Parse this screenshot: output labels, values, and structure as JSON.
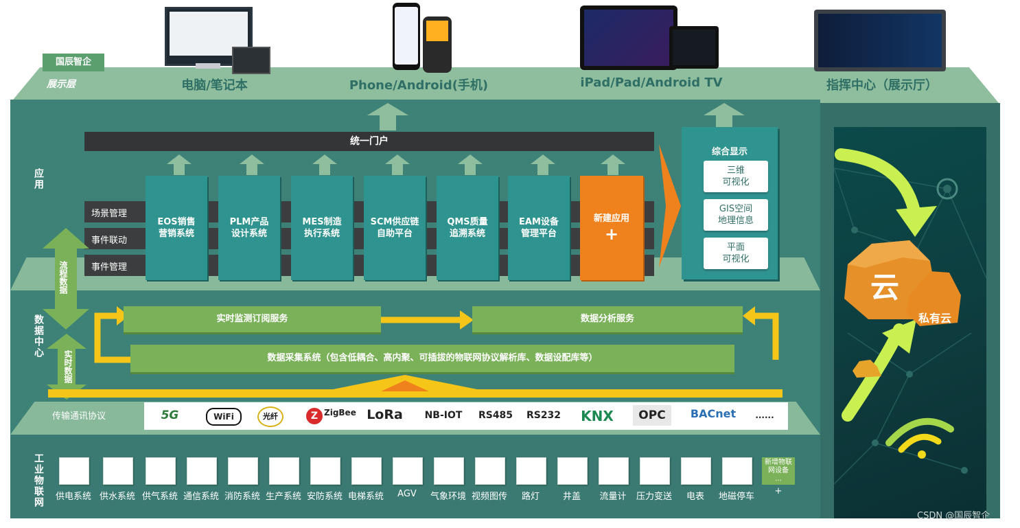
{
  "brand": {
    "name": "国辰智企",
    "layer_tag": "展示层"
  },
  "devices": [
    {
      "label": "电脑/笔记本"
    },
    {
      "label": "Phone/Android(手机)"
    },
    {
      "label": "iPad/Pad/Android TV"
    },
    {
      "label": "指挥中心（展示厅）"
    }
  ],
  "app_layer": {
    "label": "应用",
    "portal": "统一门户",
    "rows": [
      "场景管理",
      "事件联动",
      "事件管理"
    ],
    "modules": [
      {
        "line1": "EOS销售",
        "line2": "营销系统"
      },
      {
        "line1": "PLM产品",
        "line2": "设计系统"
      },
      {
        "line1": "MES制造",
        "line2": "执行系统"
      },
      {
        "line1": "SCM供应链",
        "line2": "自助平台"
      },
      {
        "line1": "QMS质量",
        "line2": "追溯系统"
      },
      {
        "line1": "EAM设备",
        "line2": "管理平台"
      },
      {
        "line1": "新建应用",
        "line2": "+"
      }
    ],
    "display": {
      "title": "综合显示",
      "items": [
        {
          "line1": "三维",
          "line2": "可视化"
        },
        {
          "line1": "GIS空间",
          "line2": "地理信息"
        },
        {
          "line1": "平面",
          "line2": "可视化"
        }
      ]
    }
  },
  "flow": {
    "process_data": "流程数据",
    "realtime_data": "实时数据"
  },
  "data_center": {
    "label": "数据中心",
    "monitor": "实时监测订阅服务",
    "analysis": "数据分析服务",
    "collection": "数据采集系统（包含低耦合、高内聚、可插拔的物联网协议解析库、数据设配库等）"
  },
  "protocols": {
    "label": "传输通讯协议",
    "items": [
      "5G",
      "WiFi",
      "光纤",
      "ZigBee",
      "LoRa",
      "NB-IOT",
      "RS485",
      "RS232",
      "KNX",
      "OPC",
      "BACnet",
      "......"
    ]
  },
  "iot": {
    "label": "工业物联网",
    "items": [
      "供电系统",
      "供水系统",
      "供气系统",
      "通信系统",
      "消防系统",
      "生产系统",
      "安防系统",
      "电梯系统",
      "AGV",
      "气象环境",
      "视频图传",
      "路灯",
      "井盖",
      "流量计",
      "压力变送",
      "电表",
      "地磁停车"
    ],
    "new_item": {
      "line1": "新增物联",
      "line2": "网设备",
      "line3": "...",
      "plus": "+"
    }
  },
  "cloud": {
    "big": "云",
    "label": "私有云"
  },
  "watermark": "CSDN @国辰智企",
  "colors": {
    "teal": "#2f938f",
    "orange": "#f0821e",
    "green": "#7ab159",
    "layer": "#3d8177",
    "light": "#88b99a"
  }
}
